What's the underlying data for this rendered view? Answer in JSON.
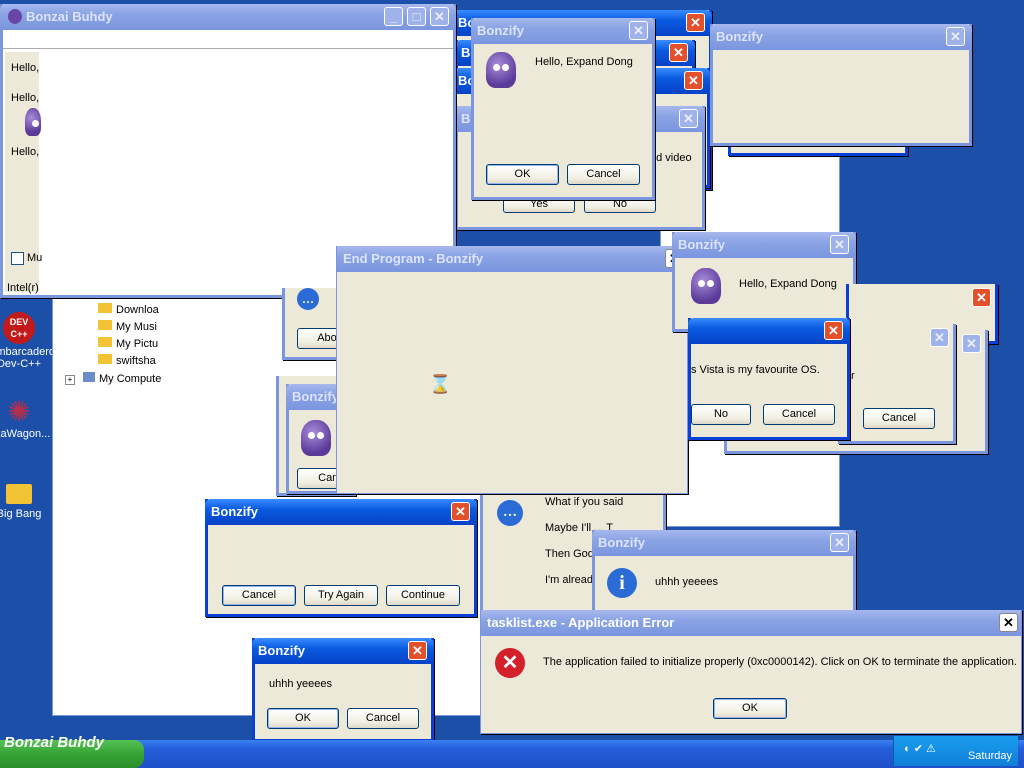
{
  "desktop": {
    "icons": [
      {
        "label": "Embarcadero Dev-C++",
        "glyph": "DEV C++",
        "color": "#c21a1a"
      },
      {
        "label": "SkaWagon...",
        "glyph": "✺",
        "color": "#b03050"
      },
      {
        "label": "Big Bang",
        "glyph": "📁",
        "color": "#f2c335"
      }
    ]
  },
  "explorer": {
    "items": [
      "Downloa",
      "My Musi",
      "My Pictu",
      "swiftsha",
      "My Compute"
    ]
  },
  "main_window": {
    "title": "Bonzai Buhdy",
    "lines": [
      "Hello,",
      "Hello,",
      "Hello,"
    ],
    "checkbox_label": "Mu",
    "status": "Intel(r)"
  },
  "dialogs": {
    "top_hello": {
      "title": "Bonzify",
      "message": "Hello, Expand Dong",
      "ok": "OK",
      "cancel": "Cancel"
    },
    "top_right": {
      "title": "Bonzify"
    },
    "yesno": {
      "title": "Bo",
      "message": "od video",
      "yes": "Yes",
      "no": "No"
    },
    "end_program": {
      "title": "End Program - Bonzify"
    },
    "hello2": {
      "title": "Bonzify",
      "message": "Hello, Expand Dong"
    },
    "vista": {
      "message": "s Vista is my favourite OS.",
      "no": "No",
      "cancel": "Cancel"
    },
    "right_cancel": {
      "cancel": "Cancel",
      "r_text": "r"
    },
    "mid_bonzi": {
      "title": "Bonzify",
      "cancel": "Car"
    },
    "about": {
      "button": "Abo"
    },
    "retry": {
      "title": "Bonzify",
      "cancel": "Cancel",
      "try_again": "Try Again",
      "continue": "Continue"
    },
    "chat": {
      "lines": [
        "What if you said",
        "Maybe I'll ... T",
        "Then God",
        "I'm alread"
      ]
    },
    "uhhh1": {
      "title": "Bonzify",
      "message": "uhhh yeeees"
    },
    "uhhh2": {
      "title": "Bonzify",
      "message": "uhhh yeeees",
      "ok": "OK",
      "cancel": "Cancel"
    },
    "app_error": {
      "title": "tasklist.exe - Application Error",
      "message": "The application failed to initialize properly (0xc0000142). Click on OK to terminate the application.",
      "ok": "OK"
    }
  },
  "taskbar": {
    "active_task": "Bonzai Buhdy",
    "day": "Saturday"
  }
}
